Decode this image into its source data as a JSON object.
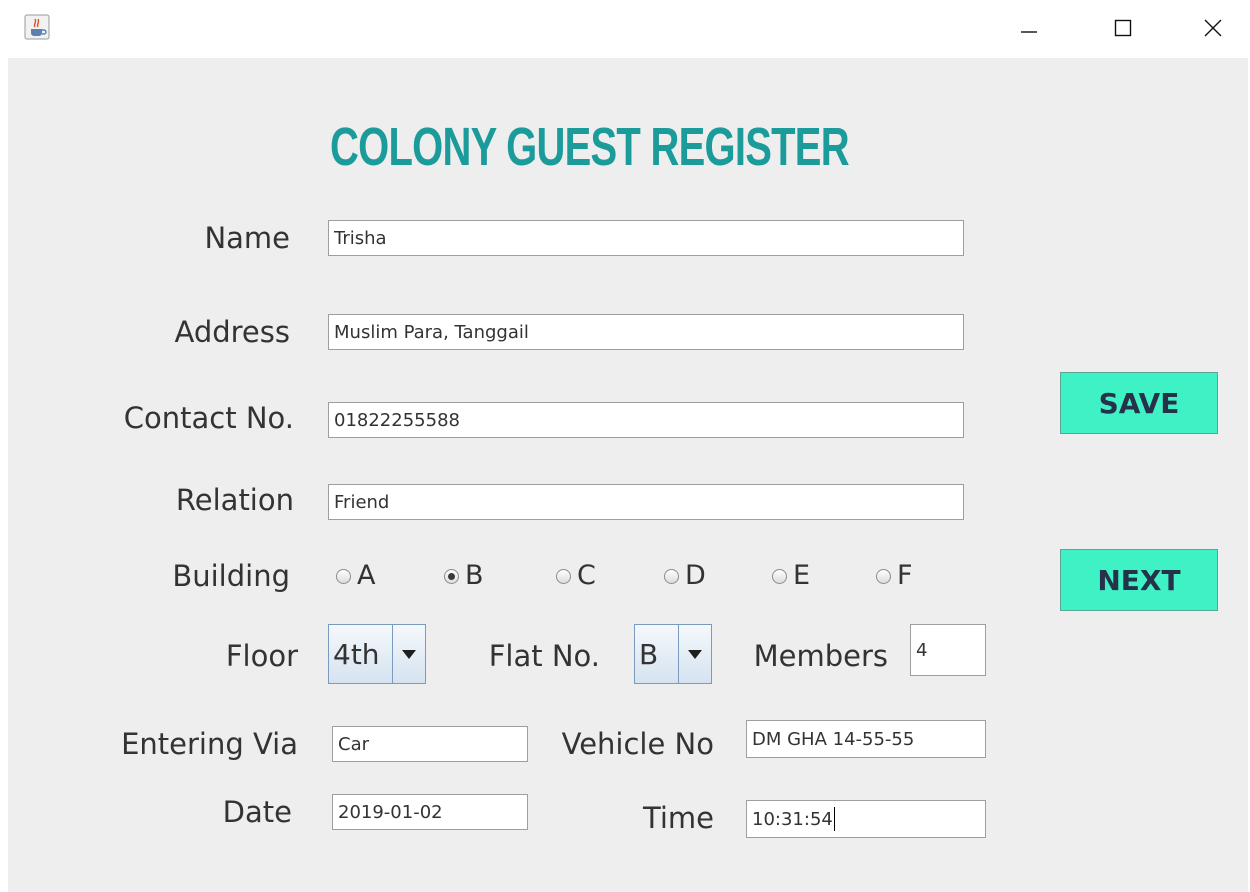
{
  "window": {
    "app_icon": "java-cup-icon",
    "controls": [
      "minimize-icon",
      "maximize-icon",
      "close-icon"
    ]
  },
  "form": {
    "title": "COLONY GUEST REGISTER",
    "name": {
      "label": "Name",
      "value": "Trisha"
    },
    "address": {
      "label": "Address",
      "value": "Muslim Para, Tanggail"
    },
    "contact": {
      "label": "Contact No.",
      "value": "01822255588"
    },
    "relation": {
      "label": "Relation",
      "value": "Friend"
    },
    "building": {
      "label": "Building",
      "options": [
        "A",
        "B",
        "C",
        "D",
        "E",
        "F"
      ],
      "selected": "B"
    },
    "floor": {
      "label": "Floor",
      "value": "4th"
    },
    "flat": {
      "label": "Flat No.",
      "value": "B"
    },
    "members": {
      "label": "Members",
      "value": "4"
    },
    "entering_via": {
      "label": "Entering Via",
      "value": "Car"
    },
    "vehicle_no": {
      "label": "Vehicle No",
      "value": "DM GHA 14-55-55"
    },
    "date": {
      "label": "Date",
      "value": "2019-01-02"
    },
    "time": {
      "label": "Time",
      "value": "10:31:54"
    }
  },
  "buttons": {
    "save": "SAVE",
    "next": "NEXT"
  },
  "colors": {
    "title": "#1c9b9b",
    "button_bg": "#3ff2c6",
    "panel_bg": "#eeeeee"
  }
}
